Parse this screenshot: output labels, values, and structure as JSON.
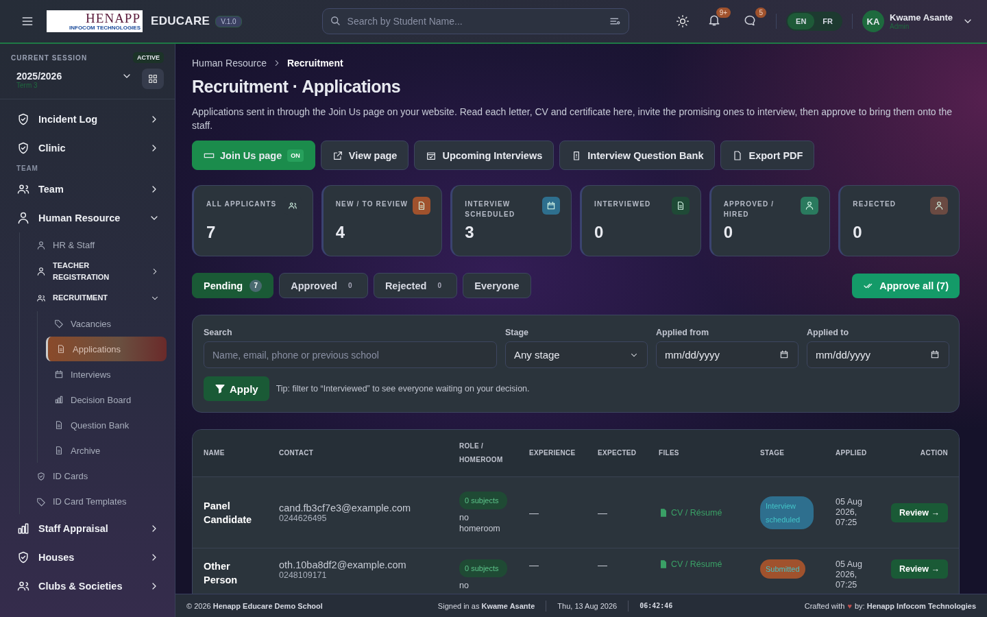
{
  "header": {
    "logo_title": "HENAPP",
    "logo_subtitle": "INFOCOM TECHNOLOGIES",
    "app_name": "EDUCARE",
    "version": "V.1.0",
    "search": {
      "placeholder": "Search by Student Name..."
    },
    "notifications_badge": "9+",
    "messages_badge": "5",
    "languages": [
      {
        "label": "EN",
        "selected": true
      },
      {
        "label": "FR",
        "selected": false
      }
    ],
    "user": {
      "initials": "KA",
      "name": "Kwame Asante",
      "role": "Admin"
    }
  },
  "session": {
    "label": "CURRENT SESSION",
    "status": "ACTIVE",
    "year": "2025/2026",
    "term": "Term 3"
  },
  "sidebar": {
    "items": [
      {
        "kind": "main",
        "label": "Incident Log",
        "expanded": false,
        "selected": false
      },
      {
        "kind": "main",
        "label": "Clinic",
        "expanded": false,
        "selected": false
      },
      {
        "kind": "section",
        "label": "TEAM"
      },
      {
        "kind": "main",
        "label": "Team",
        "expanded": false,
        "selected": false
      },
      {
        "kind": "main",
        "label": "Human Resource",
        "expanded": true,
        "selected": false,
        "children": [
          {
            "kind": "sub",
            "label": "HR & Staff",
            "selected": false
          },
          {
            "kind": "subgroup",
            "label": "TEACHER REGISTRATION",
            "expanded": false,
            "selected": false
          },
          {
            "kind": "subgroup",
            "label": "RECRUITMENT",
            "expanded": true,
            "selected": false,
            "children": [
              {
                "kind": "leaf",
                "label": "Vacancies",
                "selected": false
              },
              {
                "kind": "leaf",
                "label": "Applications",
                "selected": true
              },
              {
                "kind": "leaf",
                "label": "Interviews",
                "selected": false
              },
              {
                "kind": "leaf",
                "label": "Decision Board",
                "selected": false
              },
              {
                "kind": "leaf",
                "label": "Question Bank",
                "selected": false
              },
              {
                "kind": "leaf",
                "label": "Archive",
                "selected": false
              }
            ]
          },
          {
            "kind": "sub",
            "label": "ID Cards",
            "selected": false
          },
          {
            "kind": "sub",
            "label": "ID Card Templates",
            "selected": false
          }
        ]
      },
      {
        "kind": "main",
        "label": "Staff Appraisal",
        "expanded": false,
        "selected": false
      },
      {
        "kind": "main",
        "label": "Houses",
        "expanded": false,
        "selected": false
      },
      {
        "kind": "main",
        "label": "Clubs & Societies",
        "expanded": false,
        "selected": false
      }
    ]
  },
  "breadcrumb": [
    "Human Resource",
    "Recruitment"
  ],
  "title": "Recruitment · Applications",
  "description": "Applications sent in through the Join Us page on your website. Read each letter, CV and certificate here, invite the promising ones to interview, then approve to bring them onto the staff.",
  "actions": [
    {
      "kind": "toggle",
      "label": "Join Us page",
      "badge": "ON"
    },
    {
      "kind": "button",
      "label": "View page"
    },
    {
      "kind": "button",
      "label": "Upcoming Interviews"
    },
    {
      "kind": "button",
      "label": "Interview Question Bank"
    },
    {
      "kind": "button",
      "label": "Export PDF"
    }
  ],
  "stats": [
    {
      "label": "ALL APPLICANTS",
      "value": "7",
      "color": "#2b343c"
    },
    {
      "label": "NEW / TO REVIEW",
      "value": "4",
      "color": "#a0522d"
    },
    {
      "label": "INTERVIEW SCHEDULED",
      "value": "3",
      "color": "#2e6f8e"
    },
    {
      "label": "INTERVIEWED",
      "value": "0",
      "color": "#1f4a36"
    },
    {
      "label": "APPROVED / HIRED",
      "value": "0",
      "color": "#2a7a5e"
    },
    {
      "label": "REJECTED",
      "value": "0",
      "color": "#6a4a42"
    }
  ],
  "filter_tabs": [
    {
      "label": "Pending",
      "count": "7",
      "selected": true
    },
    {
      "label": "Approved",
      "count": "0",
      "selected": false
    },
    {
      "label": "Rejected",
      "count": "0",
      "selected": false
    },
    {
      "label": "Everyone",
      "selected": false
    }
  ],
  "approve_all": "Approve all (7)",
  "filters": {
    "search_label": "Search",
    "search_placeholder": "Name, email, phone or previous school",
    "stage_label": "Stage",
    "stage_value": "Any stage",
    "from_label": "Applied from",
    "from_placeholder": "mm/dd/yyyy",
    "to_label": "Applied to",
    "to_placeholder": "mm/dd/yyyy",
    "apply": "Apply",
    "tip": "Tip: filter to “Interviewed” to see everyone waiting on your decision."
  },
  "table": {
    "columns": [
      "NAME",
      "CONTACT",
      "ROLE / HOMEROOM",
      "EXPERIENCE",
      "EXPECTED",
      "FILES",
      "STAGE",
      "APPLIED",
      "ACTION"
    ],
    "rows": [
      {
        "name": "Panel Candidate",
        "email": "cand.fb3cf7e3@example.com",
        "phone": "0244626495",
        "subjects": "0 subjects",
        "homeroom": "no homeroom",
        "experience": "—",
        "expected": "—",
        "files": "CV / Résumé",
        "stage": "Interview scheduled",
        "color": "#2e6f8e",
        "applied": "05 Aug 2026, 07:25",
        "action": "Review →"
      },
      {
        "name": "Other Person",
        "email": "oth.10ba8df2@example.com",
        "phone": "0248109171",
        "subjects": "0 subjects",
        "homeroom": "no",
        "experience": "—",
        "expected": "—",
        "files": "CV / Résumé",
        "stage": "Submitted",
        "color": "#a0522d",
        "applied": "05 Aug 2026, 07:25",
        "action": "Review →"
      }
    ]
  },
  "footer": {
    "copyright": "© 2026 **Henapp Educare Demo School**",
    "signed_in": "Signed in as **Kwame Asante**",
    "date": "Thu, 13 Aug 2026",
    "time": "06:42:46",
    "crafted": "Crafted with",
    "heart": "♥",
    "by": "by: **Henapp Infocom Technologies**"
  }
}
